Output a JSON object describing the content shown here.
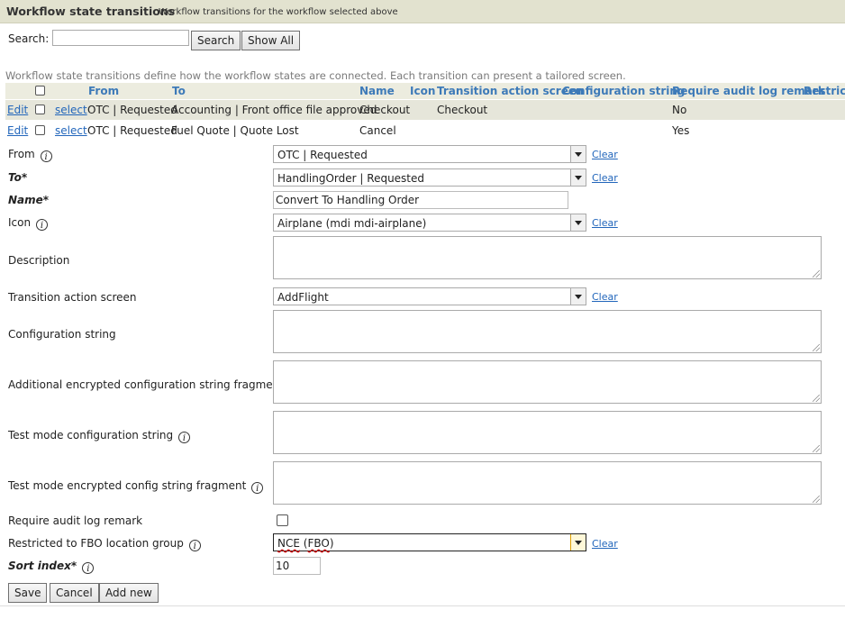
{
  "header": {
    "title": "Workflow state transitions",
    "subtitle": "Workflow transitions for the workflow selected above"
  },
  "search": {
    "label": "Search:",
    "value": "",
    "search_button": "Search",
    "show_all_button": "Show All"
  },
  "intro": "Workflow state transitions define how the workflow states are connected. Each transition can present a tailored screen.",
  "table": {
    "columns": [
      "From",
      "To",
      "Name",
      "Icon",
      "Transition action screen",
      "Configuration string",
      "Require audit log remark",
      "Restricte"
    ],
    "rows": [
      {
        "edit": "Edit",
        "select": "select",
        "from": "OTC | Requested",
        "to": "Accounting | Front office file approved",
        "name": "Checkout",
        "icon": "",
        "action_screen": "Checkout",
        "config": "",
        "audit": "No"
      },
      {
        "edit": "Edit",
        "select": "select",
        "from": "OTC | Requested",
        "to": "Fuel Quote | Quote Lost",
        "name": "Cancel",
        "icon": "",
        "action_screen": "",
        "config": "",
        "audit": "Yes"
      }
    ]
  },
  "form": {
    "from": {
      "label": "From",
      "value": "OTC | Requested",
      "clear": "Clear"
    },
    "to": {
      "label": "To*",
      "value": "HandlingOrder | Requested",
      "clear": "Clear"
    },
    "name": {
      "label": "Name*",
      "value": "Convert To Handling Order"
    },
    "icon": {
      "label": "Icon",
      "value": "Airplane (mdi mdi-airplane)",
      "clear": "Clear"
    },
    "description": {
      "label": "Description",
      "value": ""
    },
    "action_screen": {
      "label": "Transition action screen",
      "value": "AddFlight",
      "clear": "Clear"
    },
    "config": {
      "label": "Configuration string",
      "value": ""
    },
    "enc_config": {
      "label": "Additional encrypted configuration string fragment",
      "value": ""
    },
    "test_config": {
      "label": "Test mode configuration string",
      "value": ""
    },
    "test_enc": {
      "label": "Test mode encrypted config string fragment",
      "value": ""
    },
    "audit": {
      "label": "Require audit log remark",
      "checked": false
    },
    "fbo": {
      "label": "Restricted to FBO location group",
      "value_a": "NCE",
      "value_b": "FBO",
      "clear": "Clear"
    },
    "sort": {
      "label": "Sort index*",
      "value": "10"
    }
  },
  "actions": {
    "save": "Save",
    "cancel": "Cancel",
    "add_new": "Add new"
  },
  "icons": {
    "info": "info-circle-icon",
    "dropdown": "chevron-down-icon"
  }
}
